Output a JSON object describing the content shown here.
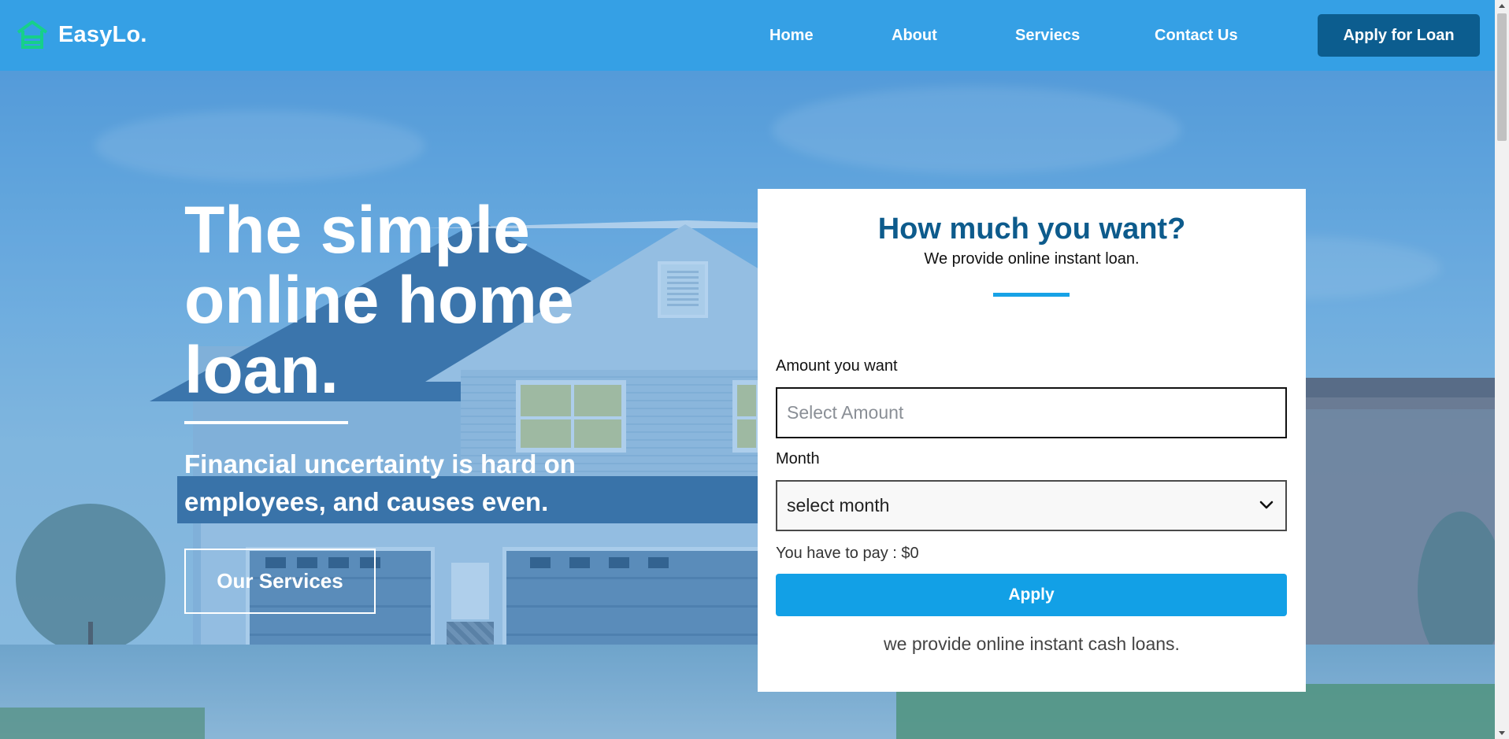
{
  "brand": {
    "name": "EasyLo.",
    "icon": "home-icon",
    "icon_color": "#16d08a"
  },
  "nav": {
    "links": [
      "Home",
      "About",
      "Serviecs",
      "Contact Us"
    ],
    "cta": "Apply for Loan"
  },
  "hero": {
    "title_lines": [
      "The simple",
      "online home",
      "loan."
    ],
    "subtitle": "Financial uncertainty is hard on employees, and causes even.",
    "button": "Our Services"
  },
  "form": {
    "title": "How much you want?",
    "subtitle": "We provide online instant loan.",
    "amount_label": "Amount you want",
    "amount_placeholder": "Select Amount",
    "amount_value": "",
    "month_label": "Month",
    "month_selected": "select month",
    "pay_label": "You have to pay : ",
    "pay_value": "$0",
    "apply_label": "Apply",
    "footer": "we provide online instant cash loans."
  },
  "colors": {
    "nav_bg": "#35a0e5",
    "cta_bg": "#0c5d8f",
    "heading": "#0d5b8c",
    "accent": "#12a0e6",
    "logo_green": "#16d08a"
  }
}
